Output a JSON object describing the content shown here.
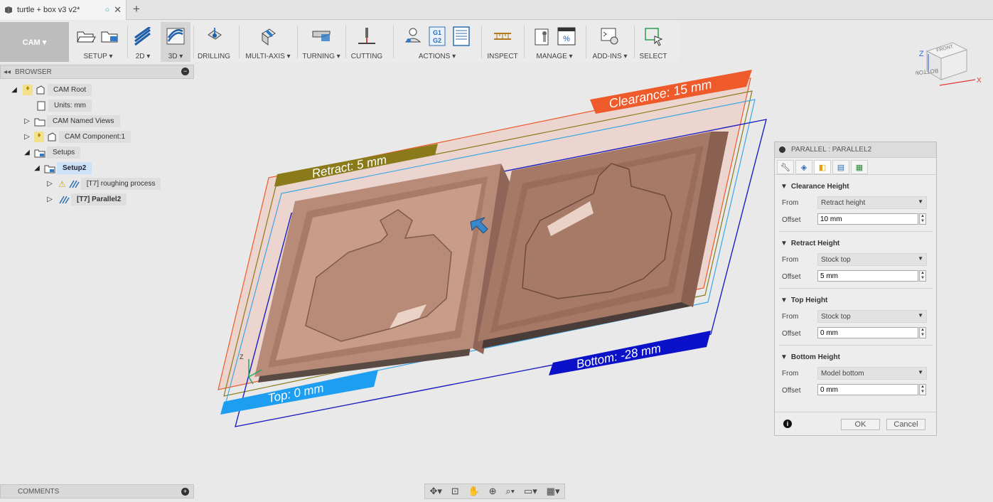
{
  "doc": {
    "title": "turtle + box v3 v2*"
  },
  "toolbar": {
    "cam_label": "CAM ▾",
    "setup": "SETUP ▾",
    "d2": "2D ▾",
    "d3": "3D ▾",
    "drilling": "DRILLING",
    "multiaxis": "MULTI-AXIS ▾",
    "turning": "TURNING ▾",
    "cutting": "CUTTING",
    "actions": "ACTIONS ▾",
    "inspect": "INSPECT",
    "manage": "MANAGE ▾",
    "addins": "ADD-INS ▾",
    "select": "SELECT",
    "actions_g1": "G1",
    "actions_g2": "G2",
    "manage_pct": "%"
  },
  "browser": {
    "title": "BROWSER",
    "nodes": [
      {
        "label": "CAM Root"
      },
      {
        "label": "Units: mm"
      },
      {
        "label": "CAM Named Views"
      },
      {
        "label": "CAM Component:1"
      },
      {
        "label": "Setups"
      },
      {
        "label": "Setup2"
      },
      {
        "label": "[T7] roughing process"
      },
      {
        "label": "[T7] Parallel2"
      }
    ]
  },
  "comments": {
    "title": "COMMENTS"
  },
  "viewport": {
    "clearance_label": "Clearance: 15 mm",
    "retract_label": "Retract: 5 mm",
    "top_label": "Top: 0 mm",
    "bottom_label": "Bottom: -28 mm",
    "axis_z": "Z",
    "colors": {
      "clearance": "#ee5a2a",
      "retract": "#8a7a1a",
      "top": "#3aa7e6",
      "bottom": "#1c1fc0"
    }
  },
  "viewcube": {
    "front": "FRONT",
    "bottom": "BOTTOM",
    "axis_z": "Z",
    "axis_x": "X"
  },
  "panel": {
    "title": "PARALLEL : PARALLEL2",
    "sections": [
      {
        "title": "Clearance Height",
        "from_label": "From",
        "from": "Retract height",
        "offset_label": "Offset",
        "offset": "10 mm"
      },
      {
        "title": "Retract Height",
        "from_label": "From",
        "from": "Stock top",
        "offset_label": "Offset",
        "offset": "5 mm"
      },
      {
        "title": "Top Height",
        "from_label": "From",
        "from": "Stock top",
        "offset_label": "Offset",
        "offset": "0 mm"
      },
      {
        "title": "Bottom Height",
        "from_label": "From",
        "from": "Model bottom",
        "offset_label": "Offset",
        "offset": "0 mm"
      }
    ],
    "ok": "OK",
    "cancel": "Cancel"
  }
}
